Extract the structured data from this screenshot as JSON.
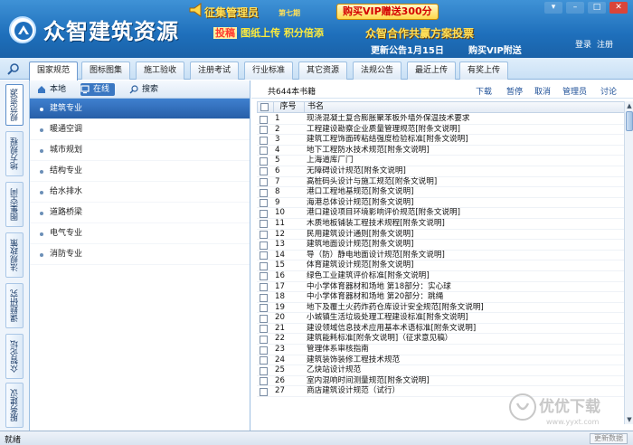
{
  "header": {
    "app_title": "众智建筑资源",
    "collect_title": "征集管理员",
    "collect_version": "第七期",
    "vip_promo": "购买VIP赠送300分",
    "promo_accent": "投稿",
    "promo_upload": "图纸上传 积分倍添",
    "slogan": "众智合作共赢方案投票",
    "notice": "更新公告1月15日",
    "buy_vip": "购买VIP附送",
    "login": "登录",
    "register": "注册"
  },
  "tabs": [
    {
      "label": "国家规范",
      "active": true
    },
    {
      "label": "图标图集",
      "active": false
    },
    {
      "label": "施工验收",
      "active": false
    },
    {
      "label": "注册考试",
      "active": false
    },
    {
      "label": "行业标准",
      "active": false
    },
    {
      "label": "其它资源",
      "active": false
    },
    {
      "label": "法规公告",
      "active": false
    },
    {
      "label": "最近上传",
      "active": false
    },
    {
      "label": "有奖上传",
      "active": false
    }
  ],
  "side_tabs": [
    {
      "label": "规范资源",
      "active": true
    },
    {
      "label": "地方规程",
      "active": false
    },
    {
      "label": "图集空间",
      "active": false
    },
    {
      "label": "法规政策",
      "active": false
    },
    {
      "label": "课题研究",
      "active": false
    },
    {
      "label": "众智论坛",
      "active": false
    },
    {
      "label": "服务建议",
      "active": false
    }
  ],
  "category_toolbar": {
    "local": "本地",
    "online": "在线",
    "search": "搜索"
  },
  "categories": [
    {
      "label": "建筑专业",
      "active": true
    },
    {
      "label": "暖通空调",
      "active": false
    },
    {
      "label": "城市规划",
      "active": false
    },
    {
      "label": "结构专业",
      "active": false
    },
    {
      "label": "给水排水",
      "active": false
    },
    {
      "label": "道路桥梁",
      "active": false
    },
    {
      "label": "电气专业",
      "active": false
    },
    {
      "label": "消防专业",
      "active": false
    }
  ],
  "content_toolbar": {
    "count": "共644本书籍",
    "download": "下载",
    "pause": "暂停",
    "cancel": "取消",
    "admin": "管理员",
    "discuss": "讨论"
  },
  "table": {
    "col_no": "序号",
    "col_name": "书名",
    "rows": [
      {
        "no": "1",
        "name": "现浇混凝土复合膨胀聚苯板外墙外保温技术要求"
      },
      {
        "no": "2",
        "name": "工程建设勘察企业质量管理规范[附条文说明]"
      },
      {
        "no": "3",
        "name": "建筑工程饰面砖粘结强度检验标准[附条文说明]"
      },
      {
        "no": "4",
        "name": "地下工程防水技术规范[附条文说明]"
      },
      {
        "no": "5",
        "name": "上海道库厂门"
      },
      {
        "no": "6",
        "name": "无障碍设计规范[附条文说明]"
      },
      {
        "no": "7",
        "name": "高桩码头设计与施工规范[附条文说明]"
      },
      {
        "no": "8",
        "name": "港口工程地基规范[附条文说明]"
      },
      {
        "no": "9",
        "name": "海港总体设计规范[附条文说明]"
      },
      {
        "no": "10",
        "name": "港口建设项目环境影响评价规范[附条文说明]"
      },
      {
        "no": "11",
        "name": "木质地板铺装工程技术规程[附条文说明]"
      },
      {
        "no": "12",
        "name": "民用建筑设计通则[附条文说明]"
      },
      {
        "no": "13",
        "name": "建筑地面设计规范[附条文说明]"
      },
      {
        "no": "14",
        "name": "导（防）静电地面设计规范[附条文说明]"
      },
      {
        "no": "15",
        "name": "体育建筑设计规范[附条文说明]"
      },
      {
        "no": "16",
        "name": "绿色工业建筑评价标准[附条文说明]"
      },
      {
        "no": "17",
        "name": "中小学体育器材和场地 第18部分：实心球"
      },
      {
        "no": "18",
        "name": "中小学体育器材和场地 第20部分：跳绳"
      },
      {
        "no": "19",
        "name": "地下及覆土火药炸药仓库设计安全规范[附条文说明]"
      },
      {
        "no": "20",
        "name": "小城镇生活垃圾处理工程建设标准[附条文说明]"
      },
      {
        "no": "21",
        "name": "建设领域信息技术应用基本术语标准[附条文说明]"
      },
      {
        "no": "22",
        "name": "建筑能耗标准[附条文说明]（征求意见稿）"
      },
      {
        "no": "23",
        "name": "管理体系审核指南"
      },
      {
        "no": "24",
        "name": "建筑装饰装修工程技术规范"
      },
      {
        "no": "25",
        "name": "乙炔站设计规范"
      },
      {
        "no": "26",
        "name": "室内混响时间测量规范[附条文说明]"
      },
      {
        "no": "27",
        "name": "商店建筑设计规范（试行）"
      }
    ]
  },
  "status": {
    "text": "就绪",
    "update_button": "更新数据"
  },
  "watermark": {
    "brand": "优优下载",
    "url": "www.yyxt.com"
  },
  "colors": {
    "header_blue": "#1e6fbb",
    "selected_blue": "#2f6bb7",
    "promo_yellow": "#ffe15a",
    "promo_red": "#d40000"
  },
  "icons": {
    "tabs_search": "magnifier-icon",
    "local": "home-icon",
    "online": "monitor-icon",
    "search": "search-icon"
  }
}
